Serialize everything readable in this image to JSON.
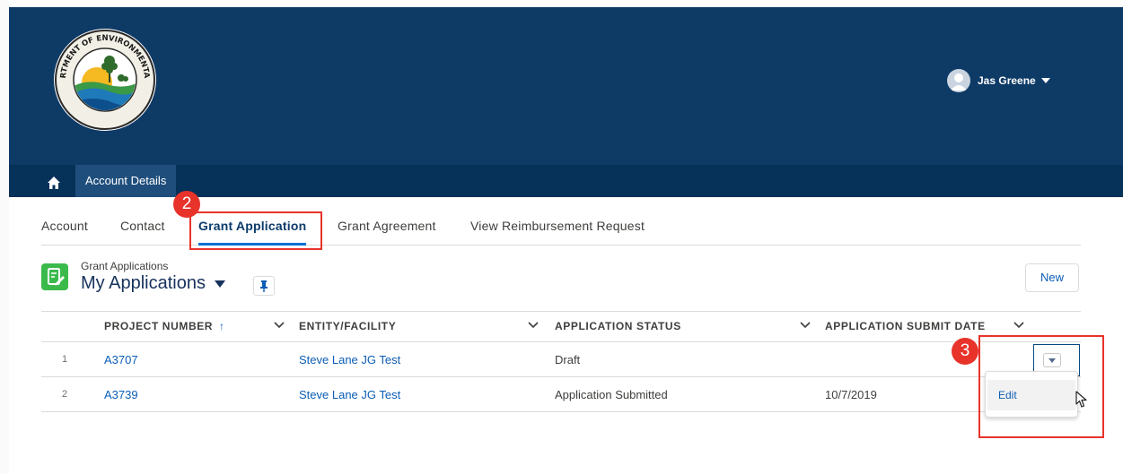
{
  "header": {
    "logo_ring_text": "FLORIDA DEPARTMENT OF ENVIRONMENTAL PROTECTION",
    "user_name": "Jas Greene"
  },
  "navbar": {
    "home_icon": "home-icon",
    "active_tab": "Account Details"
  },
  "tabs": [
    "Account",
    "Contact",
    "Grant Application",
    "Grant Agreement",
    "View Reimbursement Request"
  ],
  "callouts": [
    "2",
    "3"
  ],
  "list_view": {
    "object_label": "Grant Applications",
    "title": "My Applications",
    "new_button": "New"
  },
  "table": {
    "columns": [
      "PROJECT NUMBER",
      "ENTITY/FACILITY",
      "APPLICATION STATUS",
      "APPLICATION SUBMIT DATE"
    ],
    "sort_indicator": "↑",
    "rows": [
      {
        "num": "1",
        "project": "A3707",
        "entity": "Steve Lane JG Test",
        "status": "Draft",
        "date": ""
      },
      {
        "num": "2",
        "project": "A3739",
        "entity": "Steve Lane JG Test",
        "status": "Application Submitted",
        "date": "10/7/2019"
      }
    ]
  },
  "row_menu": {
    "items": [
      "Edit"
    ]
  },
  "colors": {
    "header_bg": "#0e3a66",
    "navbar_bg": "#063159",
    "active_tab_accent": "#0070d2",
    "link": "#0c5db5",
    "callout": "#e8332a",
    "list_icon": "#3bba4c"
  }
}
